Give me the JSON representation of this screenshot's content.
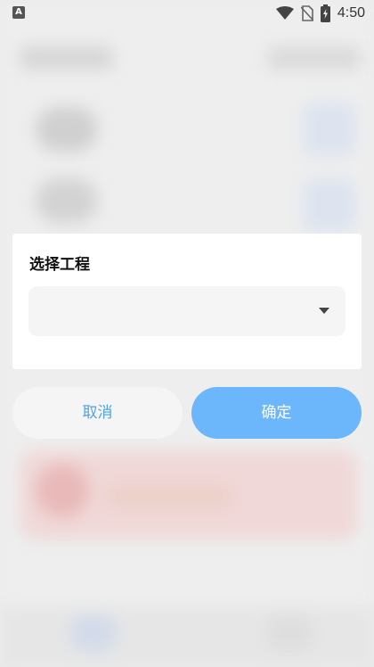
{
  "status_bar": {
    "badge": "A",
    "time": "4:50",
    "icons": [
      "wifi-icon",
      "no-sim-icon",
      "battery-charging-icon"
    ]
  },
  "dialog": {
    "title": "选择工程",
    "select_value": "",
    "select_icon": "dropdown-arrow-icon"
  },
  "buttons": {
    "cancel_label": "取消",
    "confirm_label": "确定"
  },
  "colors": {
    "primary": "#6cb6fb",
    "cancel_text": "#4fa3e6",
    "card_bg": "#ffffff",
    "field_bg": "#f5f5f5"
  }
}
